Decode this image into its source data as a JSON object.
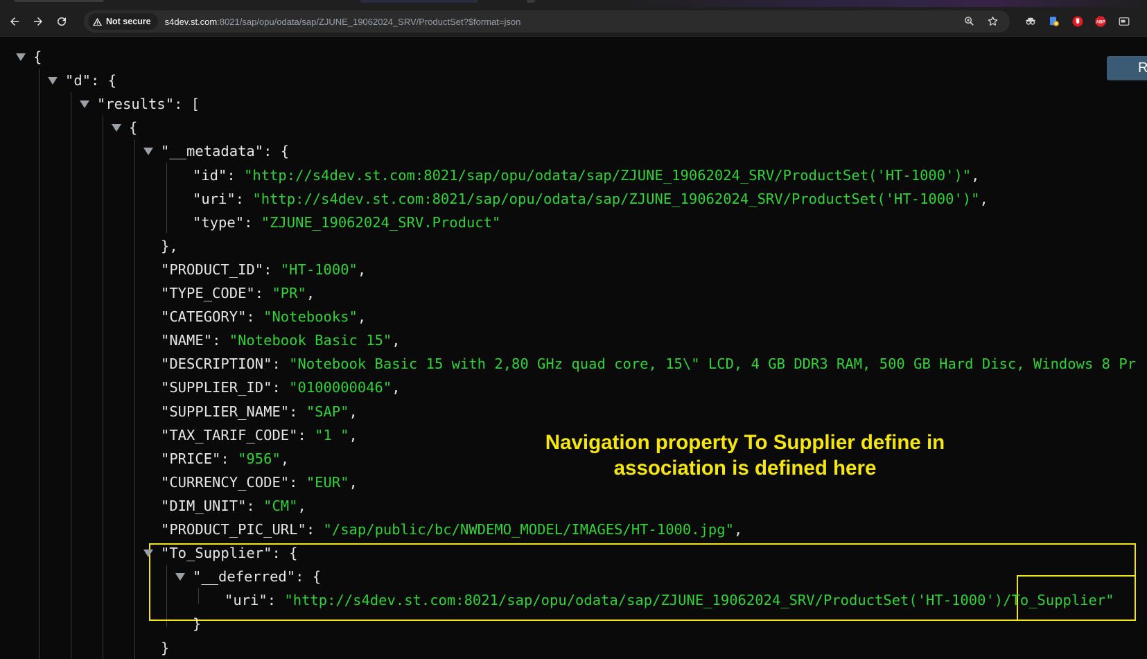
{
  "browser": {
    "security_label": "Not secure",
    "url_host": "s4dev.st.com",
    "url_rest": ":8021/sap/opu/odata/sap/ZJUNE_19062024_SRV/ProductSet?$format=json",
    "icons": [
      "back-icon",
      "forward-icon",
      "reload-icon",
      "warning-icon",
      "zoom-icon",
      "star-icon"
    ],
    "extensions": [
      "incognito-glasses-icon",
      "lens-extension-icon",
      "shield-extension-icon",
      "adblock-extension-icon",
      "media-extension-icon"
    ]
  },
  "viewer": {
    "raw_button": "R",
    "lines": [
      {
        "indent": 0,
        "tri": true,
        "parts": [
          [
            "p",
            "{"
          ]
        ]
      },
      {
        "indent": 1,
        "tri": true,
        "parts": [
          [
            "k",
            "\"d\""
          ],
          [
            "p",
            ": {"
          ]
        ]
      },
      {
        "indent": 2,
        "tri": true,
        "parts": [
          [
            "k",
            "\"results\""
          ],
          [
            "p",
            ": ["
          ]
        ]
      },
      {
        "indent": 3,
        "tri": true,
        "parts": [
          [
            "p",
            "{"
          ]
        ]
      },
      {
        "indent": 4,
        "tri": true,
        "parts": [
          [
            "k",
            "\"__metadata\""
          ],
          [
            "p",
            ": {"
          ]
        ]
      },
      {
        "indent": 5,
        "tri": false,
        "parts": [
          [
            "k",
            "\"id\""
          ],
          [
            "p",
            ": "
          ],
          [
            "s",
            "\"http://s4dev.st.com:8021/sap/opu/odata/sap/ZJUNE_19062024_SRV/ProductSet('HT-1000')\""
          ],
          [
            "p",
            ","
          ]
        ]
      },
      {
        "indent": 5,
        "tri": false,
        "parts": [
          [
            "k",
            "\"uri\""
          ],
          [
            "p",
            ": "
          ],
          [
            "s",
            "\"http://s4dev.st.com:8021/sap/opu/odata/sap/ZJUNE_19062024_SRV/ProductSet('HT-1000')\""
          ],
          [
            "p",
            ","
          ]
        ]
      },
      {
        "indent": 5,
        "tri": false,
        "parts": [
          [
            "k",
            "\"type\""
          ],
          [
            "p",
            ": "
          ],
          [
            "s",
            "\"ZJUNE_19062024_SRV.Product\""
          ]
        ]
      },
      {
        "indent": 4,
        "tri": false,
        "parts": [
          [
            "p",
            "},"
          ]
        ]
      },
      {
        "indent": 4,
        "tri": false,
        "parts": [
          [
            "k",
            "\"PRODUCT_ID\""
          ],
          [
            "p",
            ": "
          ],
          [
            "s",
            "\"HT-1000\""
          ],
          [
            "p",
            ","
          ]
        ]
      },
      {
        "indent": 4,
        "tri": false,
        "parts": [
          [
            "k",
            "\"TYPE_CODE\""
          ],
          [
            "p",
            ": "
          ],
          [
            "s",
            "\"PR\""
          ],
          [
            "p",
            ","
          ]
        ]
      },
      {
        "indent": 4,
        "tri": false,
        "parts": [
          [
            "k",
            "\"CATEGORY\""
          ],
          [
            "p",
            ": "
          ],
          [
            "s",
            "\"Notebooks\""
          ],
          [
            "p",
            ","
          ]
        ]
      },
      {
        "indent": 4,
        "tri": false,
        "parts": [
          [
            "k",
            "\"NAME\""
          ],
          [
            "p",
            ": "
          ],
          [
            "s",
            "\"Notebook Basic 15\""
          ],
          [
            "p",
            ","
          ]
        ]
      },
      {
        "indent": 4,
        "tri": false,
        "parts": [
          [
            "k",
            "\"DESCRIPTION\""
          ],
          [
            "p",
            ": "
          ],
          [
            "s",
            "\"Notebook Basic 15 with 2,80 GHz quad core, 15\\\" LCD, 4 GB DDR3 RAM, 500 GB Hard Disc, Windows 8 Pr"
          ]
        ]
      },
      {
        "indent": 4,
        "tri": false,
        "parts": [
          [
            "k",
            "\"SUPPLIER_ID\""
          ],
          [
            "p",
            ": "
          ],
          [
            "s",
            "\"0100000046\""
          ],
          [
            "p",
            ","
          ]
        ]
      },
      {
        "indent": 4,
        "tri": false,
        "parts": [
          [
            "k",
            "\"SUPPLIER_NAME\""
          ],
          [
            "p",
            ": "
          ],
          [
            "s",
            "\"SAP\""
          ],
          [
            "p",
            ","
          ]
        ]
      },
      {
        "indent": 4,
        "tri": false,
        "parts": [
          [
            "k",
            "\"TAX_TARIF_CODE\""
          ],
          [
            "p",
            ": "
          ],
          [
            "s",
            "\"1 \""
          ],
          [
            "p",
            ","
          ]
        ]
      },
      {
        "indent": 4,
        "tri": false,
        "parts": [
          [
            "k",
            "\"PRICE\""
          ],
          [
            "p",
            ": "
          ],
          [
            "s",
            "\"956\""
          ],
          [
            "p",
            ","
          ]
        ]
      },
      {
        "indent": 4,
        "tri": false,
        "parts": [
          [
            "k",
            "\"CURRENCY_CODE\""
          ],
          [
            "p",
            ": "
          ],
          [
            "s",
            "\"EUR\""
          ],
          [
            "p",
            ","
          ]
        ]
      },
      {
        "indent": 4,
        "tri": false,
        "parts": [
          [
            "k",
            "\"DIM_UNIT\""
          ],
          [
            "p",
            ": "
          ],
          [
            "s",
            "\"CM\""
          ],
          [
            "p",
            ","
          ]
        ]
      },
      {
        "indent": 4,
        "tri": false,
        "parts": [
          [
            "k",
            "\"PRODUCT_PIC_URL\""
          ],
          [
            "p",
            ": "
          ],
          [
            "s",
            "\"/sap/public/bc/NWDEMO_MODEL/IMAGES/HT-1000.jpg\""
          ],
          [
            "p",
            ","
          ]
        ]
      },
      {
        "indent": 4,
        "tri": true,
        "parts": [
          [
            "k",
            "\"To_Supplier\""
          ],
          [
            "p",
            ": {"
          ]
        ]
      },
      {
        "indent": 5,
        "tri": true,
        "parts": [
          [
            "k",
            "\"__deferred\""
          ],
          [
            "p",
            ": {"
          ]
        ]
      },
      {
        "indent": 6,
        "tri": false,
        "parts": [
          [
            "k",
            "\"uri\""
          ],
          [
            "p",
            ": "
          ],
          [
            "s",
            "\"http://s4dev.st.com:8021/sap/opu/odata/sap/ZJUNE_19062024_SRV/ProductSet('HT-1000')/To_Supplier\""
          ]
        ]
      },
      {
        "indent": 5,
        "tri": false,
        "parts": [
          [
            "p",
            "}"
          ]
        ]
      },
      {
        "indent": 4,
        "tri": false,
        "parts": [
          [
            "p",
            "}"
          ]
        ]
      }
    ]
  },
  "annotation": {
    "line1": "Navigation property To Supplier define in",
    "line2": "association is defined here"
  }
}
